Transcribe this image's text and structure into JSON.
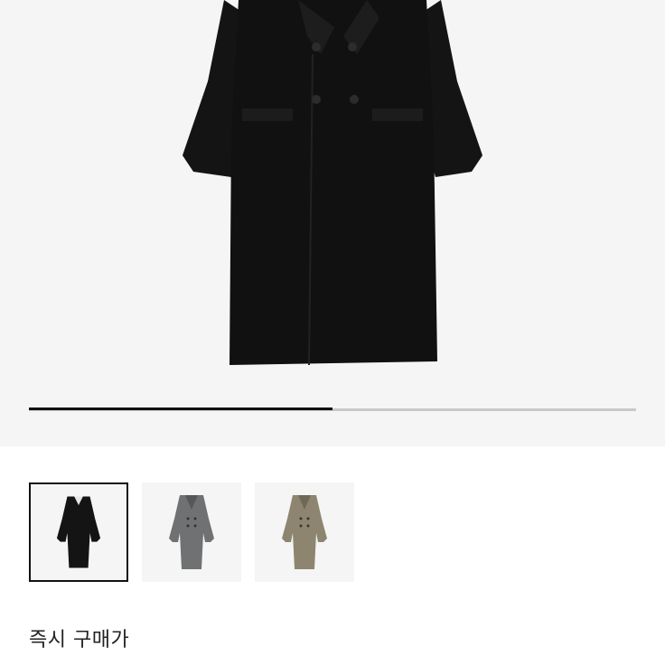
{
  "product": {
    "hero_image": "black-double-breasted-long-coat",
    "gallery_progress_fraction": 0.5,
    "colors": {
      "hero_background": "#f5f5f5",
      "coat_black": "#141414",
      "coat_grey": "#6f7173",
      "coat_beige": "#8d8570",
      "progress_track": "#c9c9c9",
      "progress_fill": "#111111"
    },
    "thumbnails": [
      {
        "name": "black-coat-thumbnail",
        "selected": true
      },
      {
        "name": "grey-coat-thumbnail",
        "selected": false
      },
      {
        "name": "beige-coat-thumbnail",
        "selected": false
      }
    ]
  },
  "purchase": {
    "instant_buy_label": "즉시 구매가"
  }
}
